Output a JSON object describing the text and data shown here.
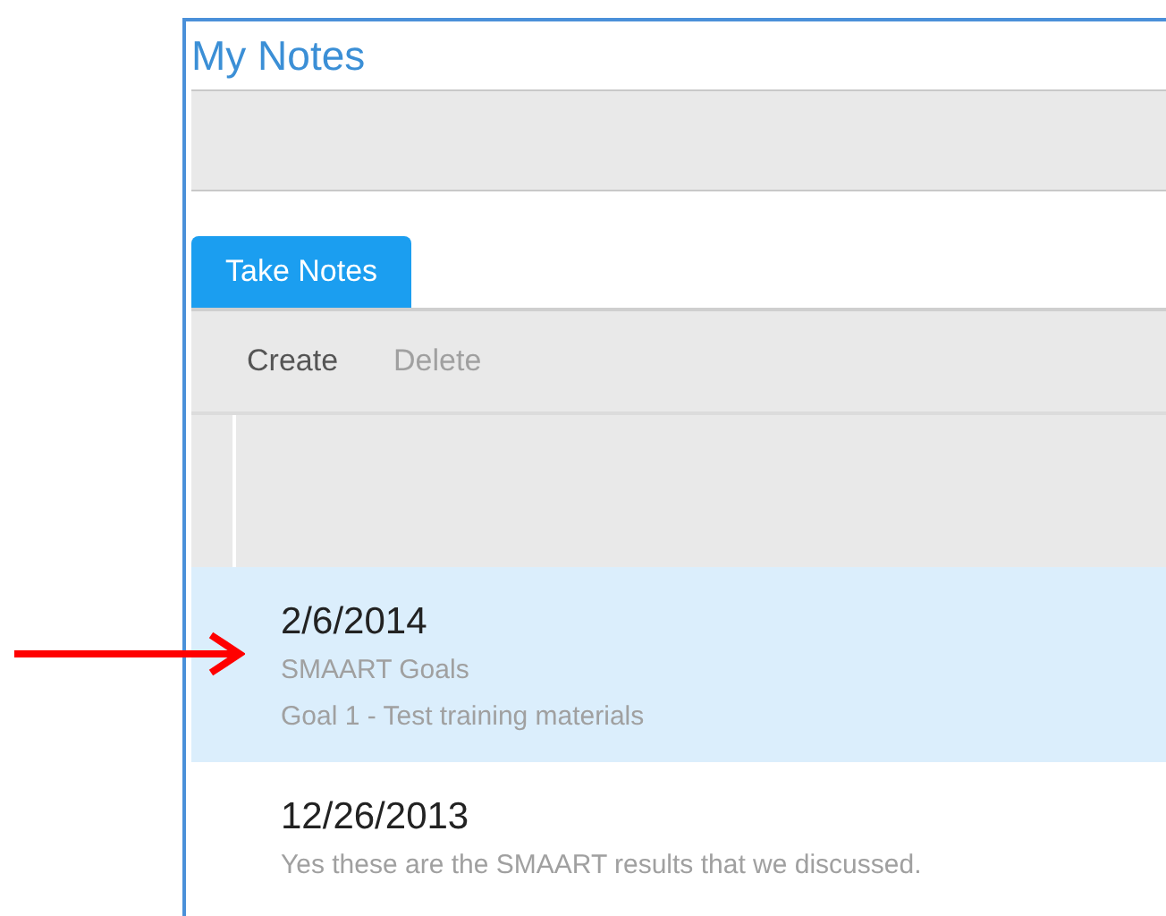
{
  "panel": {
    "title": "My Notes"
  },
  "tabs": [
    {
      "label": "Take Notes",
      "selected": true
    }
  ],
  "toolbar": [
    {
      "label": "Create",
      "disabled": false
    },
    {
      "label": "Delete",
      "disabled": true
    }
  ],
  "notes": [
    {
      "date": "2/6/2014",
      "lines": [
        "SMAART Goals",
        "Goal 1 - Test training materials"
      ],
      "selected": true
    },
    {
      "date": "12/26/2013",
      "lines": [
        "Yes these are the SMAART results that we discussed."
      ],
      "selected": false
    }
  ]
}
